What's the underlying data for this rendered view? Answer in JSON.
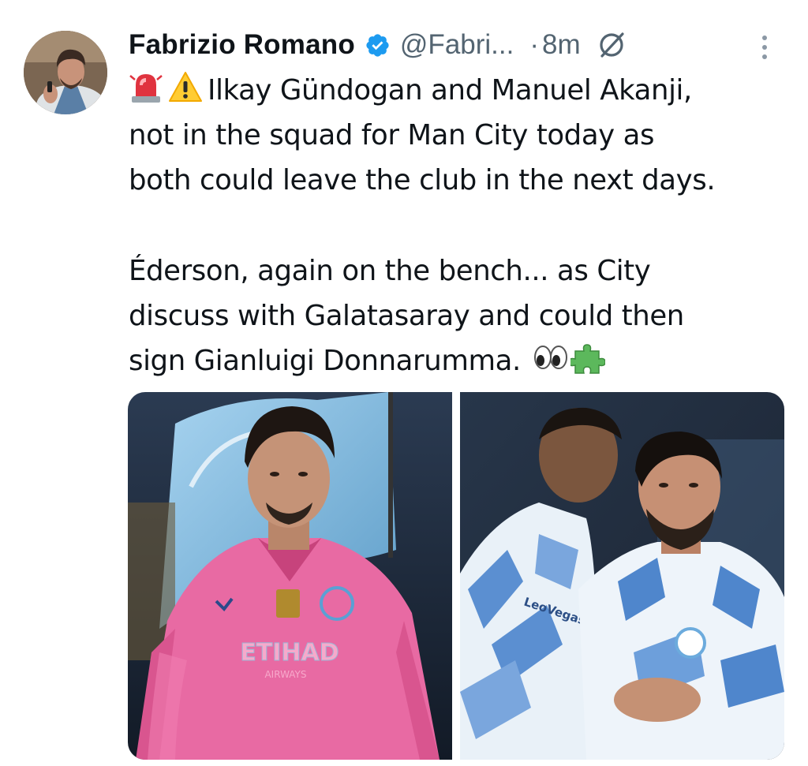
{
  "tweet": {
    "author": {
      "display_name": "Fabrizio Romano",
      "verified": true,
      "handle": "@Fabri...",
      "avatar_icon": "profile-photo"
    },
    "separator": "·",
    "time": "8m",
    "icons": {
      "verified": "verified-badge-icon",
      "grok": "grok-icon",
      "more": "more-vertical-icon"
    },
    "text": {
      "line1_emojis": [
        "🚨",
        "⚠️"
      ],
      "line1": "Ilkay Gündogan and Manuel Akanji,",
      "line2": "not in the squad for Man City today as",
      "line3": "both could leave the club in the next days.",
      "line4": "Éderson, again on the bench... as City",
      "line5": "discuss with Galatasaray and could then",
      "line6": "sign Gianluigi Donnarumma.",
      "line6_emojis": [
        "👀",
        "🧩"
      ]
    },
    "media": [
      {
        "label": "ederson-photo",
        "jersey_text": "ETIHAD",
        "jersey_subtext": "AIRWAYS"
      },
      {
        "label": "gundogan-akanji-photo",
        "jersey_text": "LeoVegas"
      }
    ],
    "colors": {
      "verified_blue": "#1d9bf0",
      "secondary_text": "#536471",
      "primary_text": "#0f1419",
      "ederson_kit": "#e86aa3",
      "city_blue": "#6cabdd"
    }
  }
}
